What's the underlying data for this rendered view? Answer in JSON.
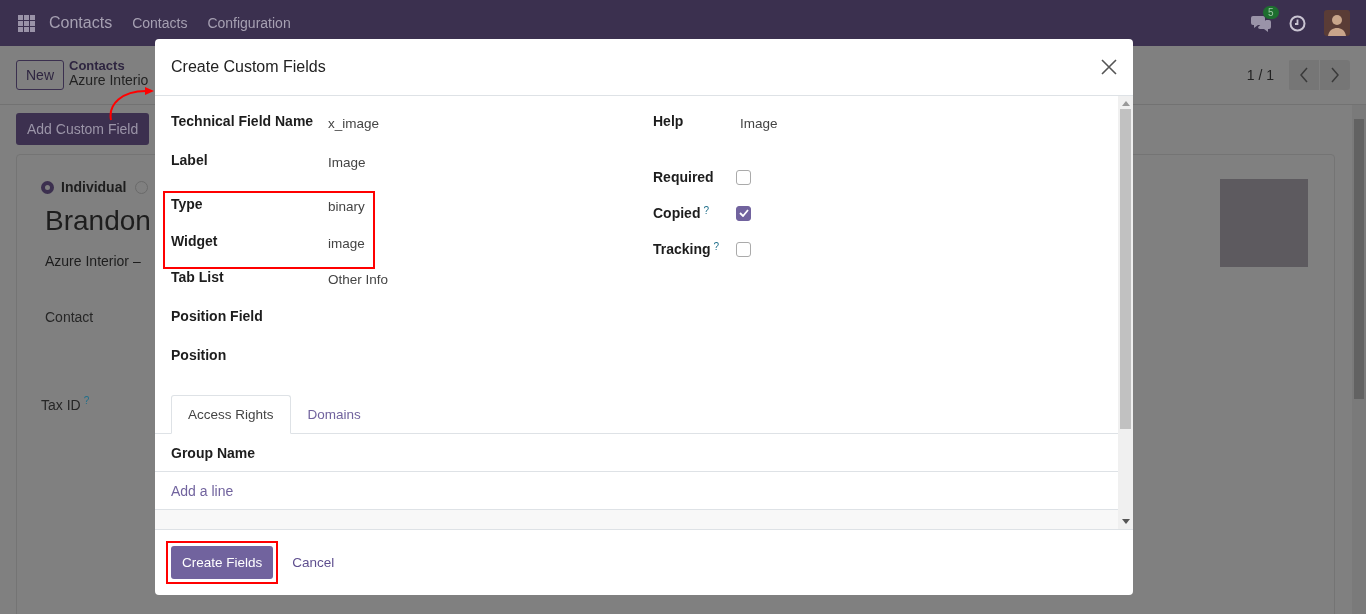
{
  "navbar": {
    "app_name": "Contacts",
    "menu": [
      "Contacts",
      "Configuration"
    ],
    "message_count": "5"
  },
  "control_panel": {
    "new_button": "New",
    "breadcrumb": {
      "parent": "Contacts",
      "current": "Azure Interio"
    },
    "pager": "1 / 1"
  },
  "add_custom_field_button": "Add Custom Field",
  "form": {
    "company_type": [
      {
        "label": "Individual",
        "selected": true
      },
      {
        "selected": false
      }
    ],
    "name": "Brandon",
    "company": "Azure Interior –",
    "fields": [
      {
        "label": "Contact"
      },
      {
        "label": "Tax ID",
        "help": "?"
      }
    ]
  },
  "dialog": {
    "title": "Create Custom Fields",
    "fields_left": [
      {
        "label": "Technical Field Name",
        "value": "x_image",
        "highlighted": false
      },
      {
        "label": "Label",
        "value": "Image",
        "highlighted": false
      },
      {
        "label": "Type",
        "value": "binary",
        "highlighted": true
      },
      {
        "label": "Widget",
        "value": "image",
        "highlighted": true
      },
      {
        "label": "Tab List",
        "value": "Other Info",
        "highlighted": false
      },
      {
        "label": "Position Field",
        "highlighted": false
      },
      {
        "label": "Position",
        "highlighted": false
      }
    ],
    "help_field": {
      "label": "Help",
      "value": "Image"
    },
    "flags": [
      {
        "label": "Required",
        "checked": false
      },
      {
        "label": "Copied",
        "help": "?",
        "checked": true
      },
      {
        "label": "Tracking",
        "help": "?",
        "checked": false
      }
    ],
    "tabs": [
      {
        "label": "Access Rights",
        "selected": true
      },
      {
        "label": "Domains",
        "selected": false
      }
    ],
    "table": {
      "columns": [
        "Group Name"
      ],
      "add_line": "Add a line"
    },
    "primary_button": {
      "label": "Create Fields",
      "highlighted": true
    },
    "secondary_button": "Cancel"
  }
}
